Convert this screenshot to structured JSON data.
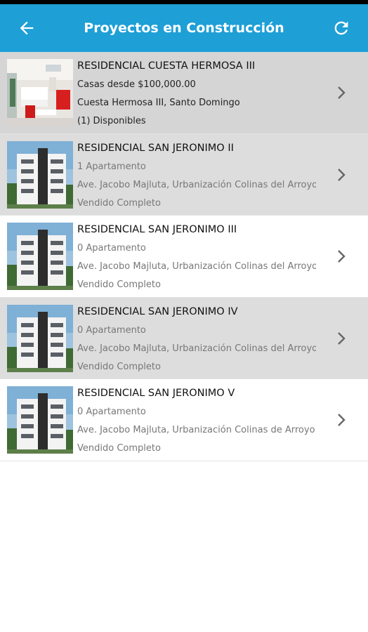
{
  "header": {
    "title": "Proyectos en Construcción",
    "back_icon": "arrow-left-icon",
    "refresh_icon": "refresh-icon",
    "accent_color": "#1e9fd6"
  },
  "projects": [
    {
      "name": "RESIDENCIAL CUESTA HERMOSA III",
      "line1": "Casas desde $100,000.00",
      "line2": "Cuesta Hermosa III, Santo Domingo",
      "line3": "(1) Disponibles"
    },
    {
      "name": "RESIDENCIAL SAN JERONIMO II",
      "line1": "1 Apartamento",
      "line2": "Ave. Jacobo Majluta, Urbanización Colinas del Arroyo",
      "line3": "Vendido Completo"
    },
    {
      "name": "RESIDENCIAL SAN JERONIMO III",
      "line1": "0 Apartamento",
      "line2": "Ave. Jacobo Majluta, Urbanización Colinas del Arroyo",
      "line3": "Vendido Completo"
    },
    {
      "name": "RESIDENCIAL SAN JERONIMO IV",
      "line1": "0 Apartamento",
      "line2": "Ave. Jacobo Majluta, Urbanización Colinas del Arroyo",
      "line3": "Vendido Completo"
    },
    {
      "name": "RESIDENCIAL SAN JERONIMO V",
      "line1": "0 Apartamento",
      "line2": "Ave. Jacobo Majluta, Urbanización Colinas de Arroyo",
      "line3": "Vendido Completo"
    }
  ]
}
